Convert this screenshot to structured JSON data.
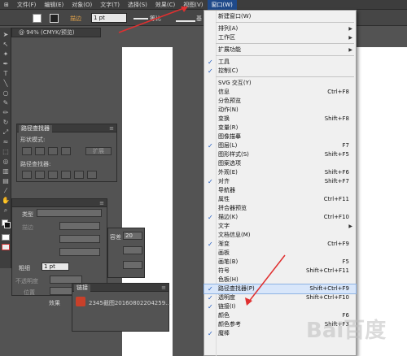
{
  "menubar": {
    "items": [
      "⊞",
      "文件(F)",
      "编辑(E)",
      "对象(O)",
      "文字(T)",
      "选择(S)",
      "效果(C)",
      "视图(V)",
      "窗口(W)"
    ]
  },
  "control_bar": {
    "stroke_label": "描边",
    "stroke_width": "1 pt",
    "profile_label": "等比",
    "brush_label": "基"
  },
  "document_tab": "@ 94% (CMYK/预览)",
  "pathfinder_panel": {
    "title": "路径查找器",
    "shape_modes_label": "形状模式:",
    "expand_button": "扩展",
    "pathfinders_label": "路径查找器:"
  },
  "type_panel": {
    "type_label": "类型",
    "stroke_label": "描边",
    "row2": "粗细",
    "weight_value": "1 pt",
    "opacity_label": "不透明度",
    "position_label": "位置",
    "field_value": "20"
  },
  "links_panel": {
    "title": "链接",
    "file_name": "2345截图20160802204259...",
    "left_label": "效果"
  },
  "window_menu": {
    "items": [
      {
        "label": "新建窗口(W)",
        "shortcut": "",
        "checked": false,
        "submenu": false
      },
      {
        "sep": true
      },
      {
        "label": "排列(A)",
        "shortcut": "",
        "checked": false,
        "submenu": true
      },
      {
        "label": "工作区",
        "shortcut": "",
        "checked": false,
        "submenu": true
      },
      {
        "sep": true
      },
      {
        "label": "扩展功能",
        "shortcut": "",
        "checked": false,
        "submenu": true
      },
      {
        "sep": true
      },
      {
        "label": "工具",
        "shortcut": "",
        "checked": true,
        "submenu": false
      },
      {
        "label": "控制(C)",
        "shortcut": "",
        "checked": true,
        "submenu": false
      },
      {
        "sep": true
      },
      {
        "label": "SVG 交互(Y)",
        "shortcut": "",
        "checked": false,
        "submenu": false
      },
      {
        "label": "信息",
        "shortcut": "Ctrl+F8",
        "checked": false,
        "submenu": false
      },
      {
        "label": "分色预览",
        "shortcut": "",
        "checked": false,
        "submenu": false
      },
      {
        "label": "动作(N)",
        "shortcut": "",
        "checked": false,
        "submenu": false
      },
      {
        "label": "变换",
        "shortcut": "Shift+F8",
        "checked": false,
        "submenu": false
      },
      {
        "label": "变量(R)",
        "shortcut": "",
        "checked": false,
        "submenu": false
      },
      {
        "label": "图像描摹",
        "shortcut": "",
        "checked": false,
        "submenu": false
      },
      {
        "label": "图层(L)",
        "shortcut": "F7",
        "checked": true,
        "submenu": false
      },
      {
        "label": "图形样式(S)",
        "shortcut": "Shift+F5",
        "checked": false,
        "submenu": false
      },
      {
        "label": "图案选项",
        "shortcut": "",
        "checked": false,
        "submenu": false
      },
      {
        "label": "外观(E)",
        "shortcut": "Shift+F6",
        "checked": false,
        "submenu": false
      },
      {
        "label": "对齐",
        "shortcut": "Shift+F7",
        "checked": true,
        "submenu": false
      },
      {
        "label": "导航器",
        "shortcut": "",
        "checked": false,
        "submenu": false
      },
      {
        "label": "属性",
        "shortcut": "Ctrl+F11",
        "checked": false,
        "submenu": false
      },
      {
        "label": "拼合器预览",
        "shortcut": "",
        "checked": false,
        "submenu": false
      },
      {
        "label": "描边(K)",
        "shortcut": "Ctrl+F10",
        "checked": true,
        "submenu": false
      },
      {
        "label": "文字",
        "shortcut": "",
        "checked": false,
        "submenu": true
      },
      {
        "label": "文档信息(M)",
        "shortcut": "",
        "checked": false,
        "submenu": false
      },
      {
        "label": "渐变",
        "shortcut": "Ctrl+F9",
        "checked": true,
        "submenu": false
      },
      {
        "label": "画板",
        "shortcut": "",
        "checked": false,
        "submenu": false
      },
      {
        "label": "画笔(B)",
        "shortcut": "F5",
        "checked": false,
        "submenu": false
      },
      {
        "label": "符号",
        "shortcut": "Shift+Ctrl+F11",
        "checked": false,
        "submenu": false
      },
      {
        "label": "色板(H)",
        "shortcut": "",
        "checked": false,
        "submenu": false
      },
      {
        "label": "路径查找器(P)",
        "shortcut": "Shift+Ctrl+F9",
        "checked": true,
        "submenu": false,
        "highlighted": true
      },
      {
        "label": "透明度",
        "shortcut": "Shift+Ctrl+F10",
        "checked": true,
        "submenu": false
      },
      {
        "label": "链接(I)",
        "shortcut": "",
        "checked": true,
        "submenu": false
      },
      {
        "label": "颜色",
        "shortcut": "F6",
        "checked": false,
        "submenu": false
      },
      {
        "label": "颜色参考",
        "shortcut": "Shift+F3",
        "checked": false,
        "submenu": false
      },
      {
        "label": "魔棒",
        "shortcut": "",
        "checked": true,
        "submenu": false
      }
    ]
  },
  "watermark": "Bai百度"
}
